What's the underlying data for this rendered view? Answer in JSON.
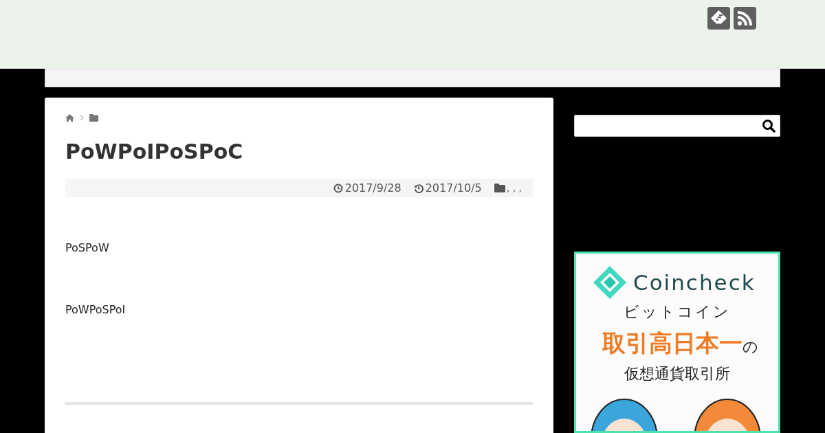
{
  "article": {
    "title": "PoWPoIPoSPoC",
    "published": "2017/9/28",
    "updated": "2017/10/5",
    "categories": ", , ,",
    "paragraphs": [
      "PoSPoW",
      "PoWPoSPoI"
    ]
  },
  "sidebar": {
    "ad": {
      "brand": "Coincheck",
      "line_1": "ビットコイン",
      "highlight": "取引高日本一",
      "particle": "の",
      "line_3": "仮想通貨取引所"
    }
  }
}
